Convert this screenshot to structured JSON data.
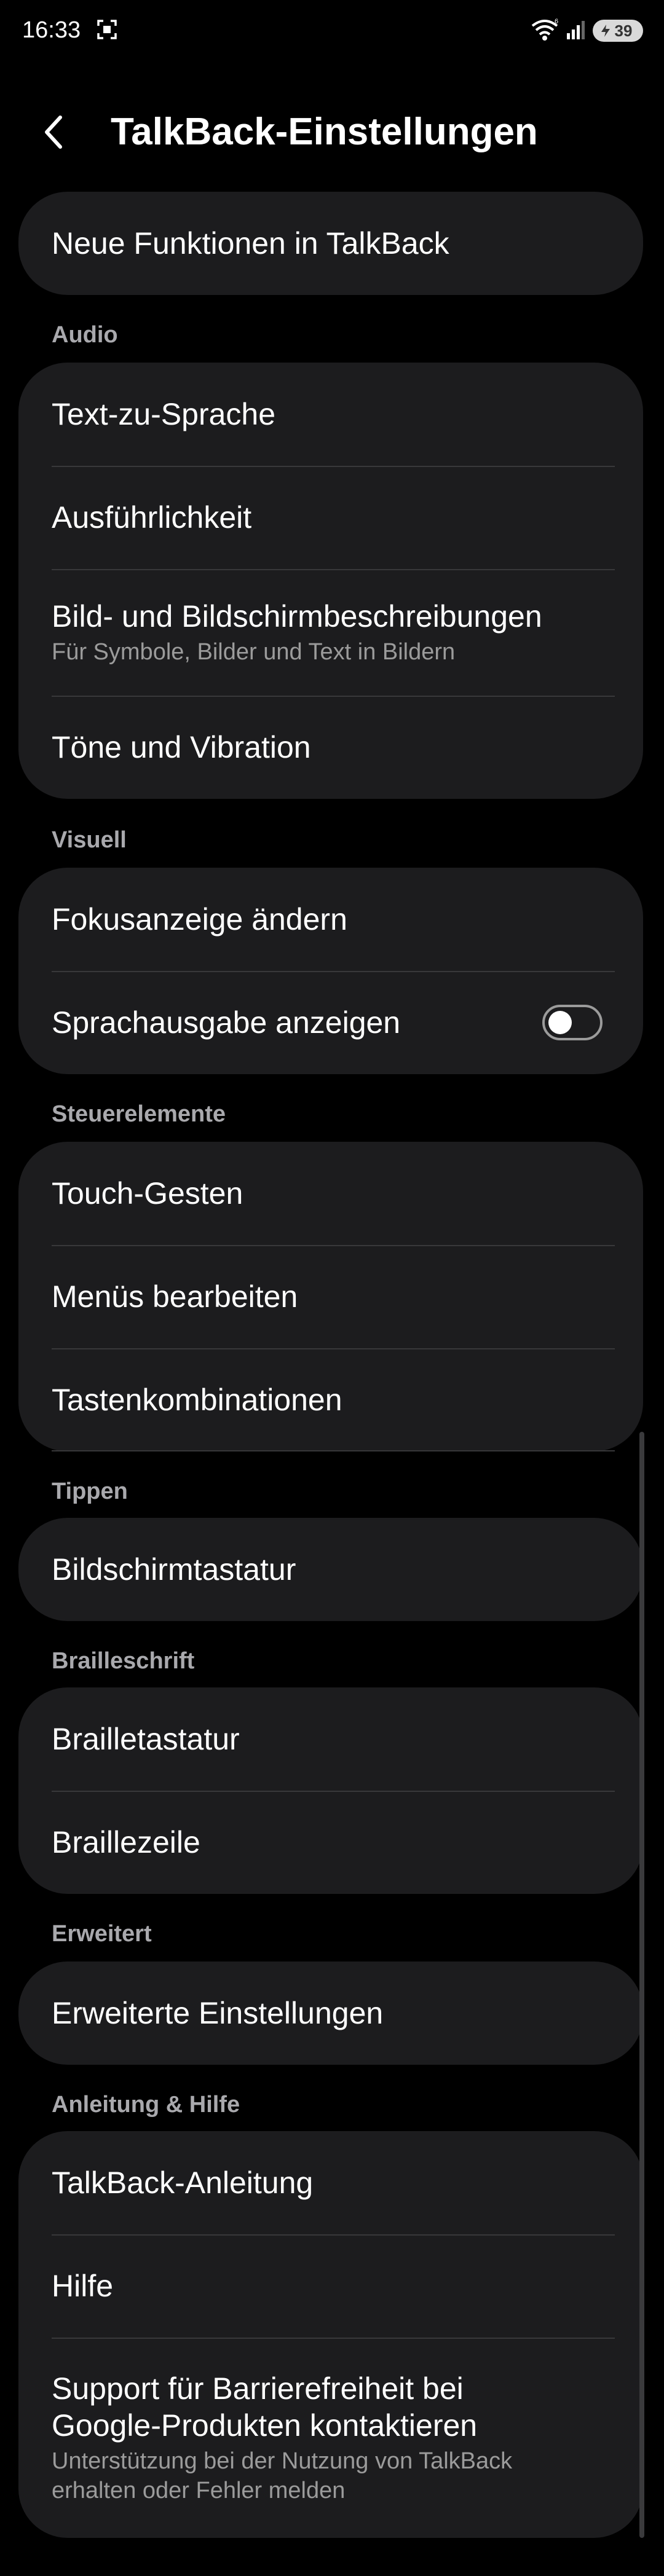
{
  "status_bar": {
    "time": "16:33",
    "battery": "39",
    "icons": [
      "screenshot-icon",
      "wifi-icon",
      "signal-icon",
      "battery-icon"
    ]
  },
  "header": {
    "title": "TalkBack-Einstellungen",
    "back_icon": "back-arrow-icon"
  },
  "top_card": {
    "item": "Neue Funktionen in TalkBack"
  },
  "sections": {
    "audio": {
      "header": "Audio",
      "items": [
        {
          "title": "Text-zu-Sprache"
        },
        {
          "title": "Ausführlichkeit"
        },
        {
          "title": "Bild- und Bildschirmbeschreibungen",
          "subtitle": "Für Symbole, Bilder und Text in Bildern"
        },
        {
          "title": "Töne und Vibration"
        }
      ]
    },
    "visuell": {
      "header": "Visuell",
      "items": [
        {
          "title": "Fokusanzeige ändern"
        },
        {
          "title": "Sprachausgabe anzeigen",
          "toggle": false
        }
      ]
    },
    "steuerelemente": {
      "header": "Steuerelemente",
      "items": [
        {
          "title": "Touch-Gesten"
        },
        {
          "title": "Menüs bearbeiten"
        },
        {
          "title": "Tastenkombinationen"
        }
      ]
    },
    "tippen": {
      "header": "Tippen",
      "items": [
        {
          "title": "Bildschirmtastatur"
        }
      ]
    },
    "brailleschrift": {
      "header": "Brailleschrift",
      "items": [
        {
          "title": "Brailletastatur"
        },
        {
          "title": "Braillezeile"
        }
      ]
    },
    "erweitert": {
      "header": "Erweitert",
      "items": [
        {
          "title": "Erweiterte Einstellungen"
        }
      ]
    },
    "hilfe": {
      "header": "Anleitung & Hilfe",
      "items": [
        {
          "title": "TalkBack-Anleitung"
        },
        {
          "title": "Hilfe"
        },
        {
          "title": "Support für Barrierefreiheit bei Google-Produkten kontaktieren",
          "subtitle": "Unterstützung bei der Nutzung von TalkBack erhalten oder Fehler melden"
        }
      ]
    }
  },
  "colors": {
    "background": "#000000",
    "card": "#1c1c1e",
    "divider": "#38383a",
    "section_header": "#a9a9ad",
    "subtitle": "#9b9b9b"
  }
}
